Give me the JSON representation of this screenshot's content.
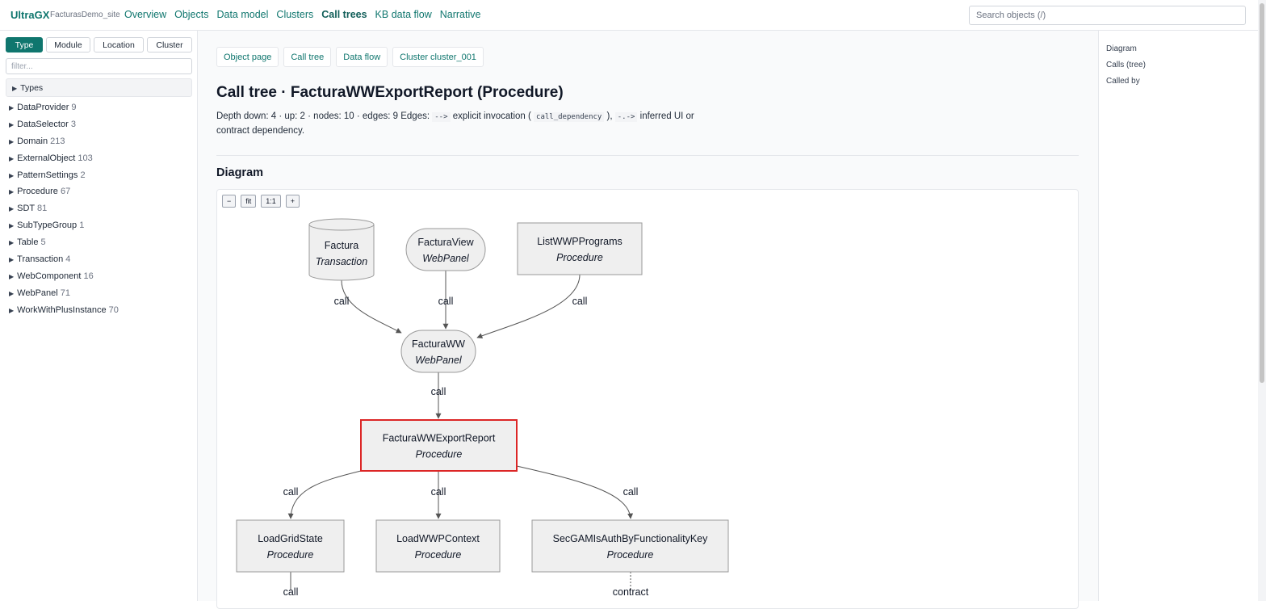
{
  "header": {
    "brand": "UltraGX",
    "site": "FacturasDemo_site",
    "nav": [
      {
        "label": "Overview",
        "active": false
      },
      {
        "label": "Objects",
        "active": false
      },
      {
        "label": "Data model",
        "active": false
      },
      {
        "label": "Clusters",
        "active": false
      },
      {
        "label": "Call trees",
        "active": true
      },
      {
        "label": "KB data flow",
        "active": false
      },
      {
        "label": "Narrative",
        "active": false
      }
    ],
    "search_placeholder": "Search objects (/)"
  },
  "sidebar": {
    "tabs": [
      "Type",
      "Module",
      "Location",
      "Cluster"
    ],
    "active_tab": "Type",
    "filter_placeholder": "filter...",
    "types_heading": "Types",
    "items": [
      {
        "label": "DataProvider",
        "count": "9"
      },
      {
        "label": "DataSelector",
        "count": "3"
      },
      {
        "label": "Domain",
        "count": "213"
      },
      {
        "label": "ExternalObject",
        "count": "103"
      },
      {
        "label": "PatternSettings",
        "count": "2"
      },
      {
        "label": "Procedure",
        "count": "67"
      },
      {
        "label": "SDT",
        "count": "81"
      },
      {
        "label": "SubTypeGroup",
        "count": "1"
      },
      {
        "label": "Table",
        "count": "5"
      },
      {
        "label": "Transaction",
        "count": "4"
      },
      {
        "label": "WebComponent",
        "count": "16"
      },
      {
        "label": "WebPanel",
        "count": "71"
      },
      {
        "label": "WorkWithPlusInstance",
        "count": "70"
      }
    ]
  },
  "main": {
    "links": [
      "Object page",
      "Call tree",
      "Data flow",
      "Cluster cluster_001"
    ],
    "title": "Call tree · FacturaWWExportReport (Procedure)",
    "desc_prefix": "Depth down: 4 · up: 2 · nodes: 10 · edges: 9 Edges: ",
    "desc_arrow1": "-->",
    "desc_mid1": " explicit invocation ( ",
    "desc_code": "call_dependency",
    "desc_mid2": " ), ",
    "desc_arrow2": "-.->",
    "desc_suffix": " inferred UI or contract dependency.",
    "section_title": "Diagram",
    "zoom_buttons": [
      "−",
      "fit",
      "1:1",
      "+"
    ]
  },
  "diagram": {
    "colors": {
      "node_fill": "#efefef",
      "node_stroke": "#9a9a9a",
      "edge": "#555555",
      "highlight": "#dc2626"
    },
    "nodes": [
      {
        "id": "factura",
        "label": "Factura",
        "kind": "Transaction",
        "shape": "cylinder"
      },
      {
        "id": "facturaview",
        "label": "FacturaView",
        "kind": "WebPanel",
        "shape": "pill"
      },
      {
        "id": "listwwp",
        "label": "ListWWPPrograms",
        "kind": "Procedure",
        "shape": "rect"
      },
      {
        "id": "facturaww",
        "label": "FacturaWW",
        "kind": "WebPanel",
        "shape": "pill"
      },
      {
        "id": "export",
        "label": "FacturaWWExportReport",
        "kind": "Procedure",
        "shape": "rect",
        "highlight": true
      },
      {
        "id": "loadgrid",
        "label": "LoadGridState",
        "kind": "Procedure",
        "shape": "rect"
      },
      {
        "id": "loadwwp",
        "label": "LoadWWPContext",
        "kind": "Procedure",
        "shape": "rect"
      },
      {
        "id": "secgam",
        "label": "SecGAMIsAuthByFunctionalityKey",
        "kind": "Procedure",
        "shape": "rect"
      }
    ],
    "edges": [
      {
        "from": "factura",
        "to": "facturaww",
        "label": "call"
      },
      {
        "from": "facturaview",
        "to": "facturaww",
        "label": "call"
      },
      {
        "from": "listwwp",
        "to": "facturaww",
        "label": "call"
      },
      {
        "from": "facturaww",
        "to": "export",
        "label": "call"
      },
      {
        "from": "export",
        "to": "loadgrid",
        "label": "call"
      },
      {
        "from": "export",
        "to": "loadwwp",
        "label": "call"
      },
      {
        "from": "export",
        "to": "secgam",
        "label": "call"
      },
      {
        "from": "loadgrid",
        "to": "",
        "label": "call"
      },
      {
        "from": "secgam",
        "to": "",
        "label": "contract",
        "dashed": true
      }
    ]
  },
  "rail": {
    "items": [
      "Diagram",
      "Calls (tree)",
      "Called by"
    ]
  }
}
